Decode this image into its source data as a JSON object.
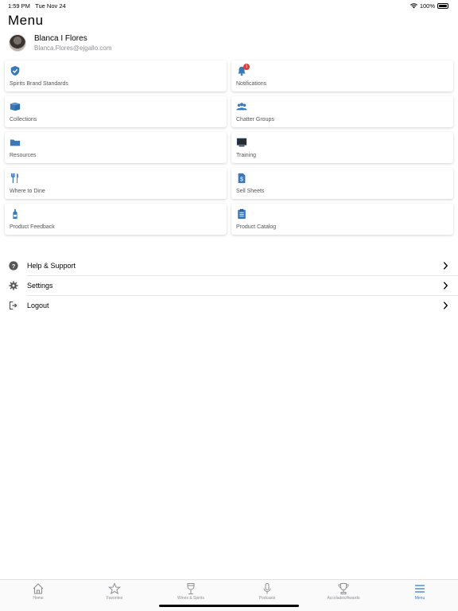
{
  "status": {
    "time": "1:59 PM",
    "date": "Tue Nov 24",
    "battery": "100%"
  },
  "page": {
    "title": "Menu"
  },
  "profile": {
    "name": "Blanca I Flores",
    "email": "Blanca.Flores@ejgallo.com"
  },
  "tiles": [
    {
      "label": "Spirits Brand Standards",
      "icon": "shield-check-icon"
    },
    {
      "label": "Notifications",
      "icon": "bell-icon",
      "badge": "1"
    },
    {
      "label": "Collections",
      "icon": "box-icon"
    },
    {
      "label": "Chatter Groups",
      "icon": "people-icon"
    },
    {
      "label": "Resources",
      "icon": "folder-icon"
    },
    {
      "label": "Training",
      "icon": "monitor-icon"
    },
    {
      "label": "Where to Dine",
      "icon": "fork-knife-icon"
    },
    {
      "label": "Sell Sheets",
      "icon": "dollar-doc-icon"
    },
    {
      "label": "Product Feedback",
      "icon": "bottle-icon"
    },
    {
      "label": "Product Catalog",
      "icon": "clipboard-list-icon"
    }
  ],
  "menu": [
    {
      "label": "Help & Support",
      "icon": "question-circle-icon"
    },
    {
      "label": "Settings",
      "icon": "gear-icon"
    },
    {
      "label": "Logout",
      "icon": "logout-icon"
    }
  ],
  "tabs": [
    {
      "label": "Home",
      "icon": "home-icon"
    },
    {
      "label": "Favorites",
      "icon": "star-icon"
    },
    {
      "label": "Wines & Spirits",
      "icon": "glass-icon"
    },
    {
      "label": "Podcasts",
      "icon": "microphone-icon"
    },
    {
      "label": "Accolades/Awards",
      "icon": "trophy-icon"
    },
    {
      "label": "Menu",
      "icon": "hamburger-icon",
      "active": true
    }
  ],
  "colors": {
    "accent": "#2f7fc8",
    "icon_blue": "#3a78b8",
    "badge": "#e53935"
  }
}
